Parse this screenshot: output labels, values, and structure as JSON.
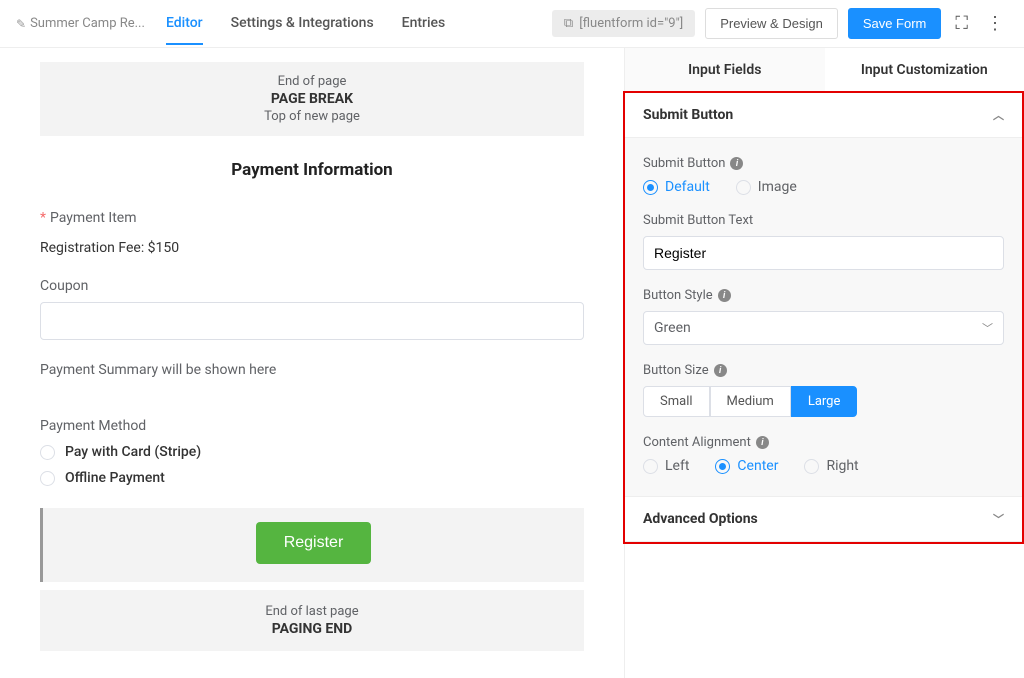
{
  "header": {
    "breadcrumb": "Summer Camp Re...",
    "tabs": {
      "editor": "Editor",
      "settings": "Settings & Integrations",
      "entries": "Entries"
    },
    "shortcode": "[fluentform id=\"9\"]",
    "preview": "Preview & Design",
    "save": "Save Form"
  },
  "canvas": {
    "pageBreak": {
      "top": "End of page",
      "mid": "PAGE BREAK",
      "bot": "Top of new page"
    },
    "sectionTitle": "Payment Information",
    "paymentItem": {
      "label": "Payment Item",
      "value": "Registration Fee: $150"
    },
    "coupon": {
      "label": "Coupon"
    },
    "summary": "Payment Summary will be shown here",
    "paymentMethod": {
      "label": "Payment Method",
      "opt1": "Pay with Card (Stripe)",
      "opt2": "Offline Payment"
    },
    "submit": "Register",
    "pagingEnd": {
      "top": "End of last page",
      "mid": "PAGING END"
    }
  },
  "sidebar": {
    "tab1": "Input Fields",
    "tab2": "Input Customization",
    "submitButton": {
      "title": "Submit Button",
      "typeLabel": "Submit Button",
      "opt1": "Default",
      "opt2": "Image",
      "textLabel": "Submit Button Text",
      "textValue": "Register",
      "styleLabel": "Button Style",
      "styleValue": "Green",
      "sizeLabel": "Button Size",
      "size1": "Small",
      "size2": "Medium",
      "size3": "Large",
      "alignLabel": "Content Alignment",
      "align1": "Left",
      "align2": "Center",
      "align3": "Right"
    },
    "advanced": "Advanced Options"
  }
}
